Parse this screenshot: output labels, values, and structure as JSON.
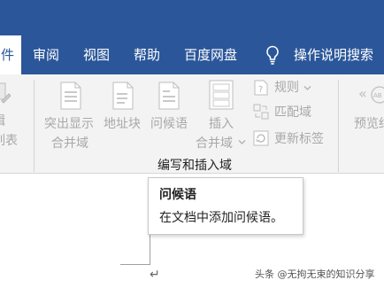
{
  "tabs": [
    {
      "label": "件",
      "active": true
    },
    {
      "label": "审阅",
      "active": false
    },
    {
      "label": "视图",
      "active": false
    },
    {
      "label": "帮助",
      "active": false
    },
    {
      "label": "百度网盘",
      "active": false
    }
  ],
  "tell_me": {
    "label": "操作说明搜索",
    "icon": "lightbulb-icon"
  },
  "ribbon": {
    "left_partial": {
      "line1": "辑",
      "line2": "列表",
      "icon": "mail-merge-recipients-icon"
    },
    "highlight_fields": {
      "line1": "突出显示",
      "line2": "合并域",
      "icon": "highlight-merge-fields-icon"
    },
    "address_block": {
      "label": "地址块",
      "icon": "address-block-icon"
    },
    "greeting_line": {
      "label": "问候语",
      "icon": "greeting-line-icon"
    },
    "insert_merge_field": {
      "line1": "插入",
      "line2": "合并域",
      "icon": "insert-merge-field-icon"
    },
    "rules": {
      "label": "规则",
      "icon": "rules-icon"
    },
    "match_fields": {
      "label": "匹配域",
      "icon": "match-fields-icon"
    },
    "update_labels": {
      "label": "更新标签",
      "icon": "update-labels-icon"
    },
    "preview": {
      "label": "预览结",
      "icon": "preview-results-icon"
    },
    "group_label": "编写和插入域"
  },
  "tooltip": {
    "title": "问候语",
    "description": "在文档中添加问候语。"
  },
  "watermark": "头条 @无拘无束的知识分享",
  "colors": {
    "accent": "#2b579a",
    "ribbon_bg": "#f3f3f3",
    "disabled": "#a8a8a8"
  }
}
